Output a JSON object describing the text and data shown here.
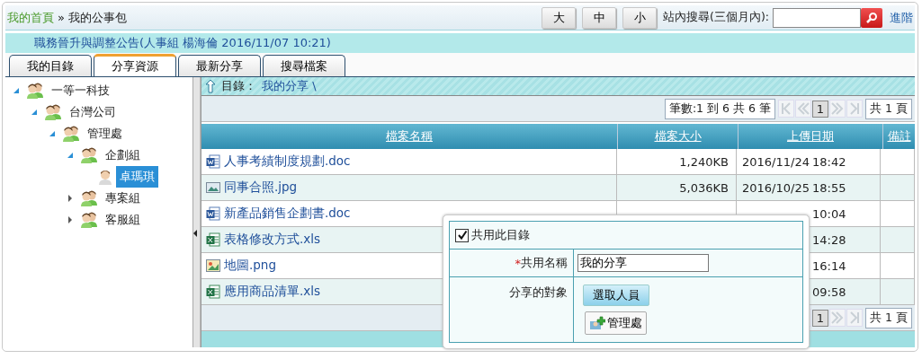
{
  "breadcrumb": {
    "home": "我的首頁",
    "separator": "»",
    "current": "我的公事包"
  },
  "font_size_buttons": [
    "大",
    "中",
    "小"
  ],
  "search": {
    "label": "站內搜尋(三個月內):",
    "advanced_link": "進階"
  },
  "announcement": "職務晉升與調整公告(人事組 楊海倫 2016/11/07 10:21)",
  "tabs": [
    {
      "label": "我的目錄",
      "selected": false
    },
    {
      "label": "分享資源",
      "selected": true
    },
    {
      "label": "最新分享",
      "selected": false
    },
    {
      "label": "搜尋檔案",
      "selected": false
    }
  ],
  "tree": [
    {
      "label": "一等一科技",
      "kind": "group",
      "expanded": true,
      "selected": false,
      "children": [
        {
          "label": "台灣公司",
          "kind": "group",
          "expanded": true,
          "selected": false,
          "children": [
            {
              "label": "管理處",
              "kind": "group",
              "expanded": true,
              "selected": false,
              "children": [
                {
                  "label": "企劃組",
                  "kind": "group",
                  "expanded": true,
                  "selected": false,
                  "children": [
                    {
                      "label": "卓瑪琪",
                      "kind": "person",
                      "selected": true
                    }
                  ]
                },
                {
                  "label": "專案組",
                  "kind": "group",
                  "expanded": false,
                  "selected": false
                },
                {
                  "label": "客服組",
                  "kind": "group",
                  "expanded": false,
                  "selected": false
                }
              ]
            }
          ]
        }
      ]
    }
  ],
  "directory": {
    "label": "目錄：",
    "path": "我的分享 \\"
  },
  "pager_top": {
    "summary": "筆數:1 到 6 共 6 筆",
    "pages": [
      {
        "label": "1",
        "selected": true
      }
    ],
    "total": "共 1 頁"
  },
  "table": {
    "columns": [
      "檔案名稱",
      "檔案大小",
      "上傳日期",
      "備註"
    ],
    "rows": [
      {
        "kind": "word",
        "name": "人事考績制度規劃.doc",
        "size": "1,240KB",
        "date": "2016/11/24",
        "time": "18:42"
      },
      {
        "kind": "image",
        "name": "同事合照.jpg",
        "size": "5,036KB",
        "date": "2016/10/25",
        "time": "18:55"
      },
      {
        "kind": "word",
        "name": "新產品銷售企劃書.doc",
        "time": "10:04"
      },
      {
        "kind": "excel",
        "name": "表格修改方式.xls",
        "time": "14:28"
      },
      {
        "kind": "map",
        "name": "地圖.png",
        "time": "16:14"
      },
      {
        "kind": "excel",
        "name": "應用商品清單.xls",
        "time": "09:58"
      }
    ]
  },
  "pager_bottom": {
    "pages": [
      {
        "label": "1",
        "selected": true
      }
    ],
    "total": "共 1 頁"
  },
  "share_dialog": {
    "share_checkbox": {
      "label": "共用此目錄",
      "checked": true
    },
    "name_field": {
      "required_mark": "*",
      "label": "共用名稱",
      "value": "我的分享"
    },
    "targets": {
      "label": "分享的對象",
      "select_button": "選取人員",
      "selected": [
        {
          "label": "管理處"
        }
      ]
    }
  }
}
